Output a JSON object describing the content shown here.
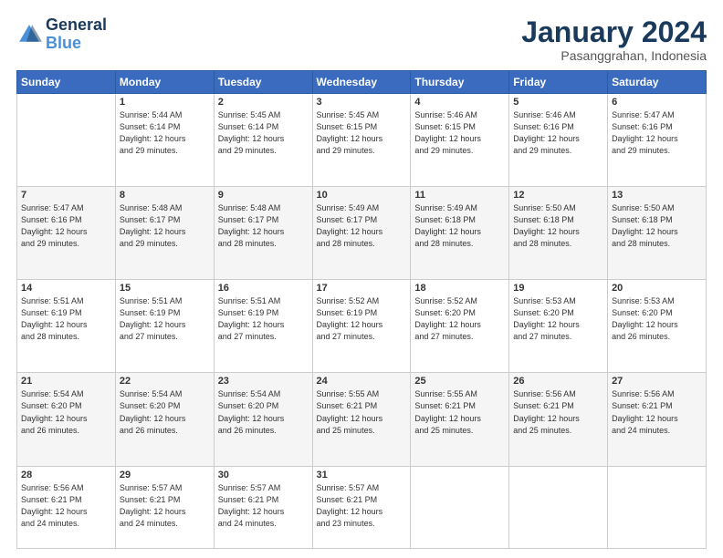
{
  "logo": {
    "line1": "General",
    "line2": "Blue"
  },
  "title": "January 2024",
  "subtitle": "Pasanggrahan, Indonesia",
  "days_of_week": [
    "Sunday",
    "Monday",
    "Tuesday",
    "Wednesday",
    "Thursday",
    "Friday",
    "Saturday"
  ],
  "weeks": [
    [
      {
        "day": "",
        "info": ""
      },
      {
        "day": "1",
        "info": "Sunrise: 5:44 AM\nSunset: 6:14 PM\nDaylight: 12 hours\nand 29 minutes."
      },
      {
        "day": "2",
        "info": "Sunrise: 5:45 AM\nSunset: 6:14 PM\nDaylight: 12 hours\nand 29 minutes."
      },
      {
        "day": "3",
        "info": "Sunrise: 5:45 AM\nSunset: 6:15 PM\nDaylight: 12 hours\nand 29 minutes."
      },
      {
        "day": "4",
        "info": "Sunrise: 5:46 AM\nSunset: 6:15 PM\nDaylight: 12 hours\nand 29 minutes."
      },
      {
        "day": "5",
        "info": "Sunrise: 5:46 AM\nSunset: 6:16 PM\nDaylight: 12 hours\nand 29 minutes."
      },
      {
        "day": "6",
        "info": "Sunrise: 5:47 AM\nSunset: 6:16 PM\nDaylight: 12 hours\nand 29 minutes."
      }
    ],
    [
      {
        "day": "7",
        "info": "Sunrise: 5:47 AM\nSunset: 6:16 PM\nDaylight: 12 hours\nand 29 minutes."
      },
      {
        "day": "8",
        "info": "Sunrise: 5:48 AM\nSunset: 6:17 PM\nDaylight: 12 hours\nand 29 minutes."
      },
      {
        "day": "9",
        "info": "Sunrise: 5:48 AM\nSunset: 6:17 PM\nDaylight: 12 hours\nand 28 minutes."
      },
      {
        "day": "10",
        "info": "Sunrise: 5:49 AM\nSunset: 6:17 PM\nDaylight: 12 hours\nand 28 minutes."
      },
      {
        "day": "11",
        "info": "Sunrise: 5:49 AM\nSunset: 6:18 PM\nDaylight: 12 hours\nand 28 minutes."
      },
      {
        "day": "12",
        "info": "Sunrise: 5:50 AM\nSunset: 6:18 PM\nDaylight: 12 hours\nand 28 minutes."
      },
      {
        "day": "13",
        "info": "Sunrise: 5:50 AM\nSunset: 6:18 PM\nDaylight: 12 hours\nand 28 minutes."
      }
    ],
    [
      {
        "day": "14",
        "info": "Sunrise: 5:51 AM\nSunset: 6:19 PM\nDaylight: 12 hours\nand 28 minutes."
      },
      {
        "day": "15",
        "info": "Sunrise: 5:51 AM\nSunset: 6:19 PM\nDaylight: 12 hours\nand 27 minutes."
      },
      {
        "day": "16",
        "info": "Sunrise: 5:51 AM\nSunset: 6:19 PM\nDaylight: 12 hours\nand 27 minutes."
      },
      {
        "day": "17",
        "info": "Sunrise: 5:52 AM\nSunset: 6:19 PM\nDaylight: 12 hours\nand 27 minutes."
      },
      {
        "day": "18",
        "info": "Sunrise: 5:52 AM\nSunset: 6:20 PM\nDaylight: 12 hours\nand 27 minutes."
      },
      {
        "day": "19",
        "info": "Sunrise: 5:53 AM\nSunset: 6:20 PM\nDaylight: 12 hours\nand 27 minutes."
      },
      {
        "day": "20",
        "info": "Sunrise: 5:53 AM\nSunset: 6:20 PM\nDaylight: 12 hours\nand 26 minutes."
      }
    ],
    [
      {
        "day": "21",
        "info": "Sunrise: 5:54 AM\nSunset: 6:20 PM\nDaylight: 12 hours\nand 26 minutes."
      },
      {
        "day": "22",
        "info": "Sunrise: 5:54 AM\nSunset: 6:20 PM\nDaylight: 12 hours\nand 26 minutes."
      },
      {
        "day": "23",
        "info": "Sunrise: 5:54 AM\nSunset: 6:20 PM\nDaylight: 12 hours\nand 26 minutes."
      },
      {
        "day": "24",
        "info": "Sunrise: 5:55 AM\nSunset: 6:21 PM\nDaylight: 12 hours\nand 25 minutes."
      },
      {
        "day": "25",
        "info": "Sunrise: 5:55 AM\nSunset: 6:21 PM\nDaylight: 12 hours\nand 25 minutes."
      },
      {
        "day": "26",
        "info": "Sunrise: 5:56 AM\nSunset: 6:21 PM\nDaylight: 12 hours\nand 25 minutes."
      },
      {
        "day": "27",
        "info": "Sunrise: 5:56 AM\nSunset: 6:21 PM\nDaylight: 12 hours\nand 24 minutes."
      }
    ],
    [
      {
        "day": "28",
        "info": "Sunrise: 5:56 AM\nSunset: 6:21 PM\nDaylight: 12 hours\nand 24 minutes."
      },
      {
        "day": "29",
        "info": "Sunrise: 5:57 AM\nSunset: 6:21 PM\nDaylight: 12 hours\nand 24 minutes."
      },
      {
        "day": "30",
        "info": "Sunrise: 5:57 AM\nSunset: 6:21 PM\nDaylight: 12 hours\nand 24 minutes."
      },
      {
        "day": "31",
        "info": "Sunrise: 5:57 AM\nSunset: 6:21 PM\nDaylight: 12 hours\nand 23 minutes."
      },
      {
        "day": "",
        "info": ""
      },
      {
        "day": "",
        "info": ""
      },
      {
        "day": "",
        "info": ""
      }
    ]
  ]
}
